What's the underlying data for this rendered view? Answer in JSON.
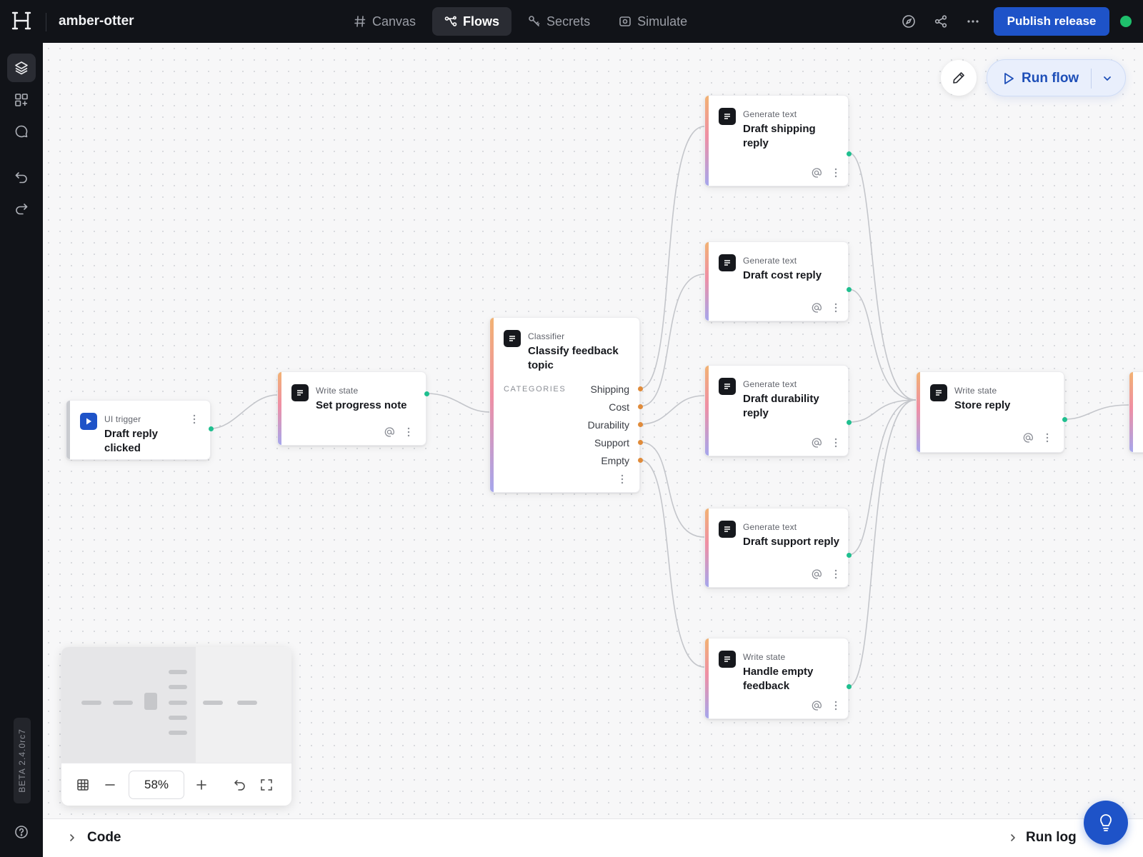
{
  "app": {
    "project_name": "amber-otter"
  },
  "header": {
    "tabs": [
      {
        "label": "Canvas",
        "icon": "hash-icon",
        "active": false
      },
      {
        "label": "Flows",
        "icon": "flow-icon",
        "active": true
      },
      {
        "label": "Secrets",
        "icon": "key-icon",
        "active": false
      },
      {
        "label": "Simulate",
        "icon": "preview-icon",
        "active": false
      }
    ],
    "tools": [
      "compass-icon",
      "share-icon",
      "more-icon"
    ],
    "publish_label": "Publish release",
    "status_color": "#1fbf6c"
  },
  "rail": {
    "items": [
      "layers-icon",
      "blocks-add-icon",
      "chat-icon",
      "undo-icon",
      "redo-icon"
    ],
    "version": "BETA 2.4.0rc7",
    "help": "help-icon"
  },
  "canvas": {
    "run_flow_label": "Run flow",
    "nodes": [
      {
        "id": "trigger",
        "type": "UI trigger",
        "title": "Draft reply clicked"
      },
      {
        "id": "progress",
        "type": "Write state",
        "title": "Set progress note"
      },
      {
        "id": "classifier",
        "type": "Classifier",
        "title": "Classify feedback topic",
        "categories_label": "CATEGORIES",
        "categories": [
          "Shipping",
          "Cost",
          "Durability",
          "Support",
          "Empty"
        ]
      },
      {
        "id": "shipping",
        "type": "Generate text",
        "title": "Draft shipping reply"
      },
      {
        "id": "cost",
        "type": "Generate text",
        "title": "Draft cost reply"
      },
      {
        "id": "durability",
        "type": "Generate text",
        "title": "Draft durability reply"
      },
      {
        "id": "support",
        "type": "Generate text",
        "title": "Draft support reply"
      },
      {
        "id": "empty",
        "type": "Write state",
        "title": "Handle empty feedback"
      },
      {
        "id": "store",
        "type": "Write state",
        "title": "Store reply"
      }
    ]
  },
  "minimap": {
    "zoom": "58%"
  },
  "bottom": {
    "code_label": "Code",
    "runlog_label": "Run log"
  },
  "colors": {
    "accent": "#1e53c8",
    "port_out": "#1fbf8f",
    "port_category": "#e08b3a"
  }
}
